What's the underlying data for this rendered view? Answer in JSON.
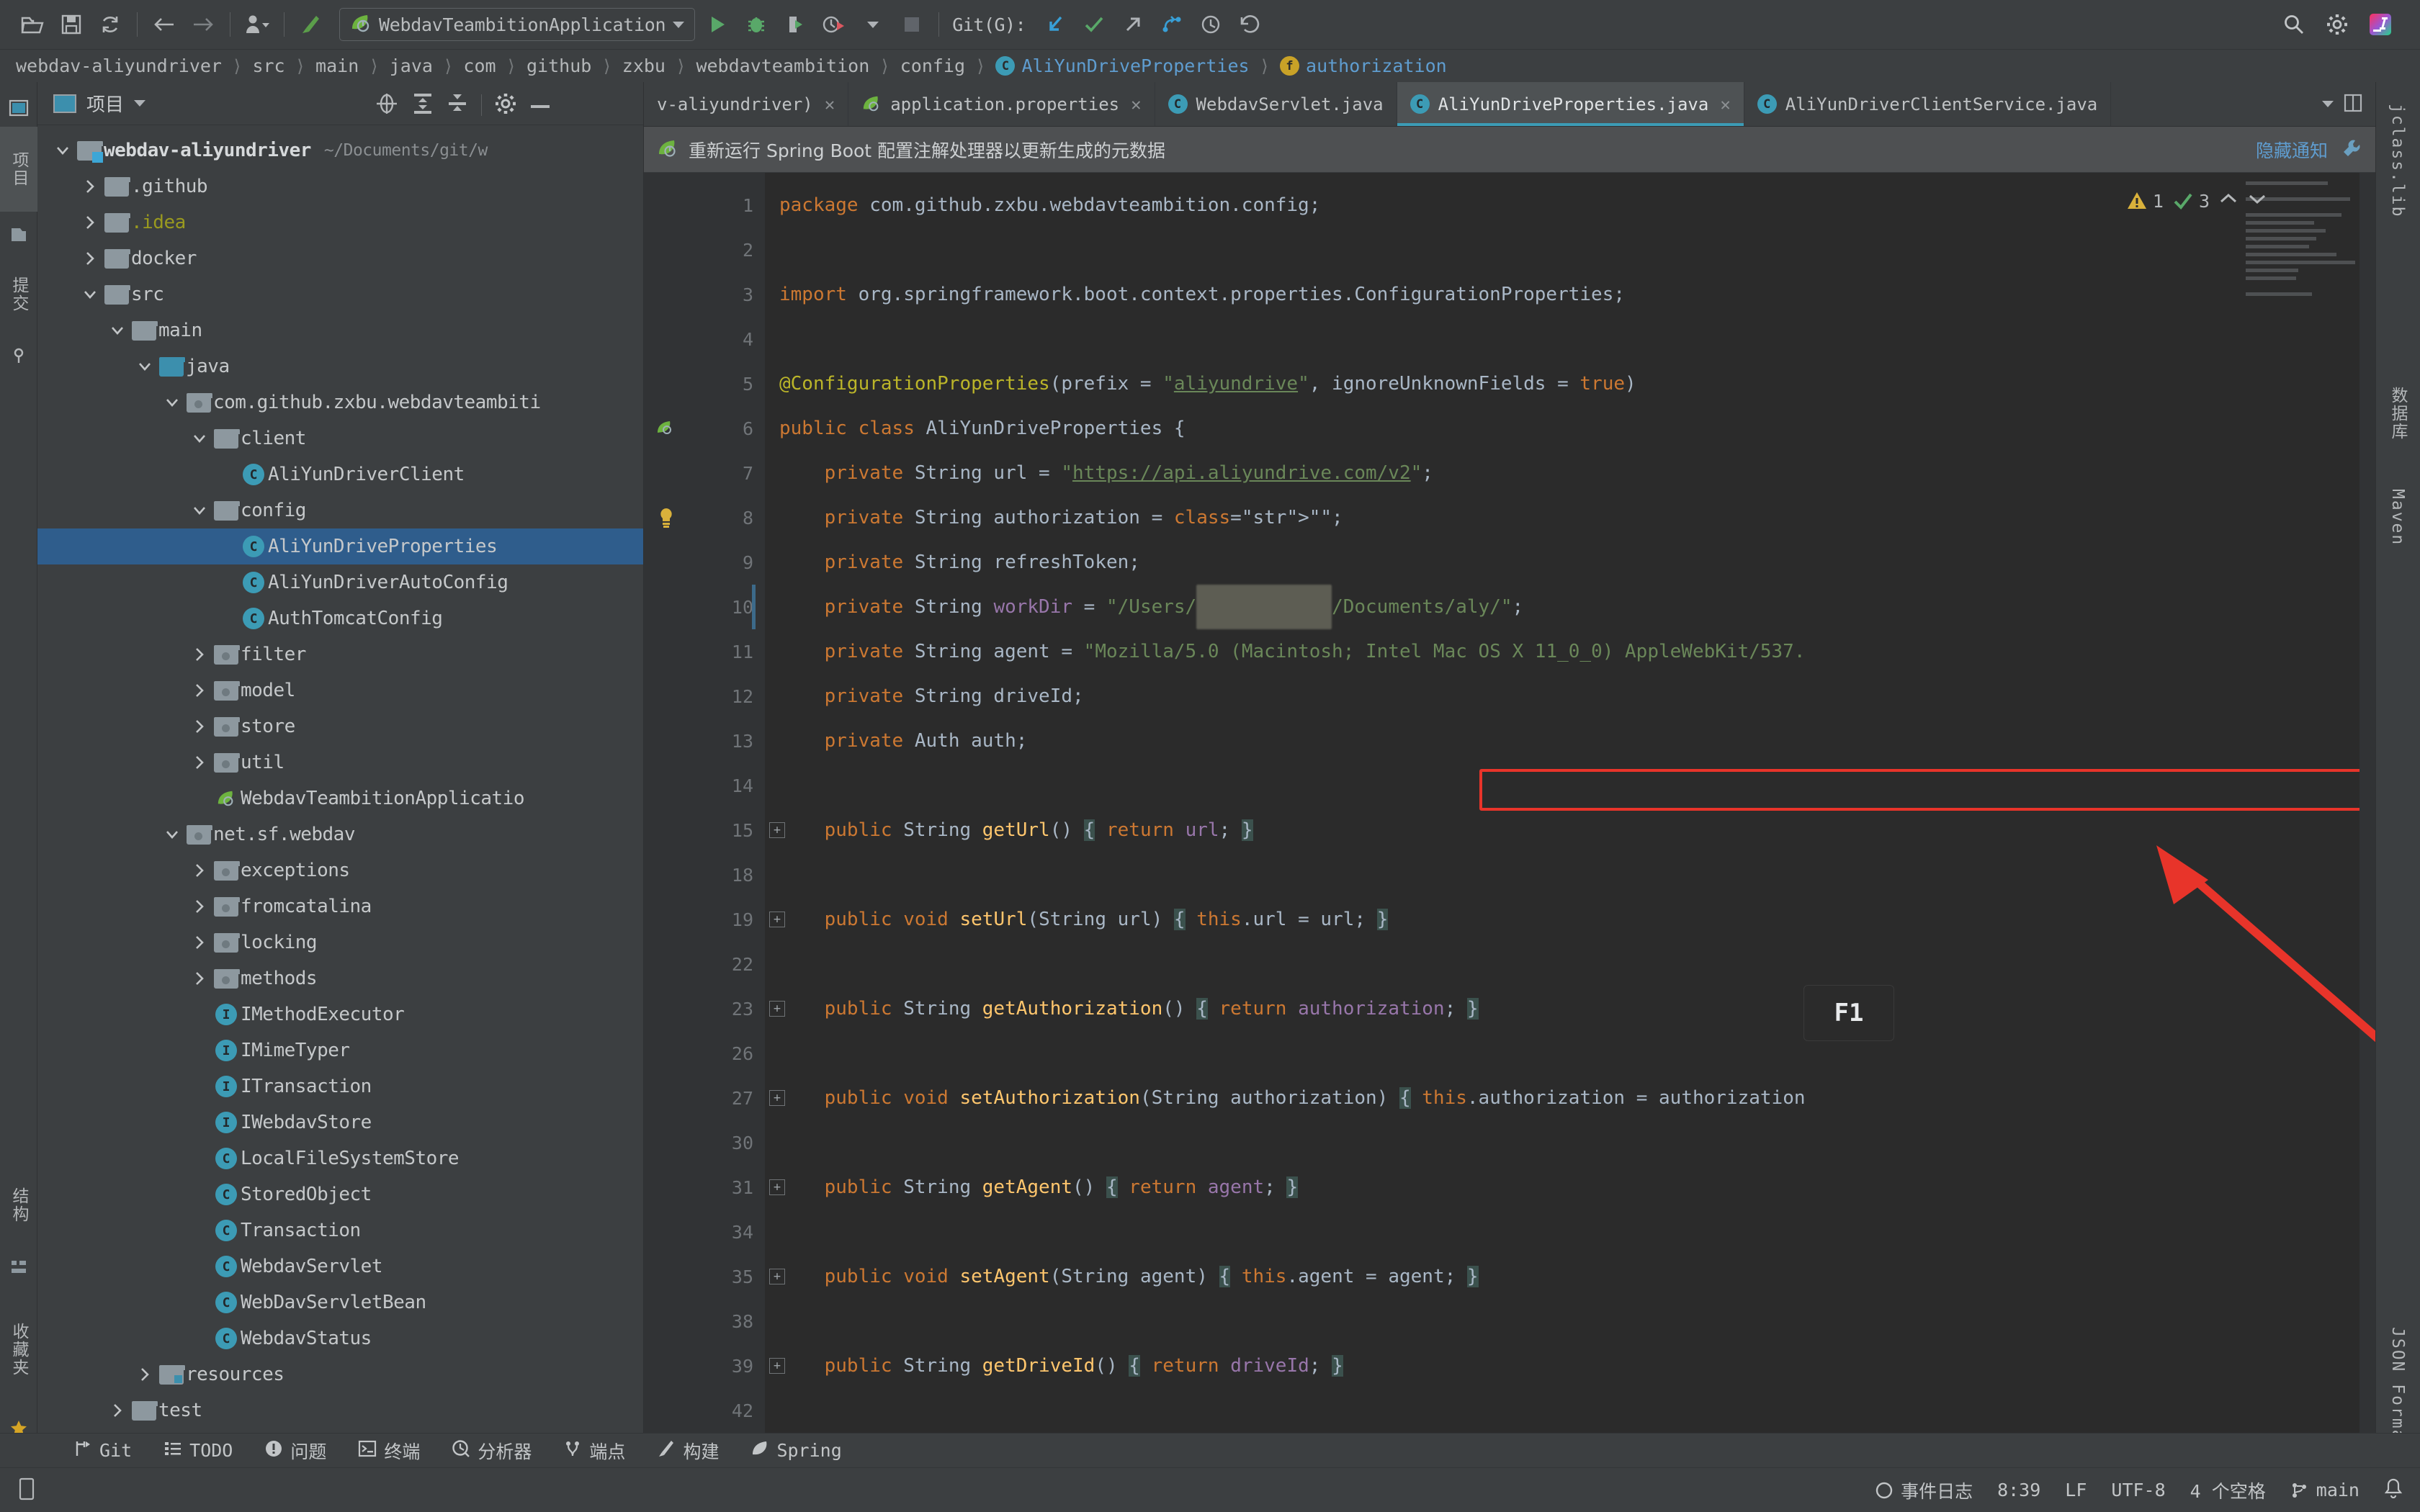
{
  "toolbar": {
    "icons": [
      "open-folder-icon",
      "save-icon",
      "sync-icon",
      "back-arrow-icon",
      "forward-arrow-icon",
      "profiler-icon",
      "build-icon"
    ],
    "run_config": "WebdavTeambitionApplication",
    "git_label": "Git(G):",
    "right_icons": [
      "search-icon",
      "settings-gear-icon",
      "intellij-logo-icon"
    ]
  },
  "breadcrumb": {
    "items": [
      "webdav-aliyundriver",
      "src",
      "main",
      "java",
      "com",
      "github",
      "zxbu",
      "webdavteambition",
      "config"
    ],
    "class_name": "AliYunDriveProperties",
    "field_name": "authorization",
    "class_badge": "C",
    "field_badge": "f"
  },
  "rail_left": {
    "items": [
      "项目",
      "提交",
      "结构",
      "收藏夹"
    ]
  },
  "rail_right": {
    "items": [
      "jclass.lib",
      "数据库",
      "Maven",
      "JSON Formatter"
    ]
  },
  "project_panel": {
    "title": "项目",
    "tree": [
      {
        "label": "webdav-aliyundriver",
        "sub": "~/Documents/git/w",
        "depth": 0,
        "twisty": "down",
        "icon": "module-folder",
        "bold": true
      },
      {
        "label": ".github",
        "depth": 1,
        "twisty": "right",
        "icon": "folder"
      },
      {
        "label": ".idea",
        "depth": 1,
        "twisty": "right",
        "icon": "folder",
        "color": "idea"
      },
      {
        "label": "docker",
        "depth": 1,
        "twisty": "right",
        "icon": "folder"
      },
      {
        "label": "src",
        "depth": 1,
        "twisty": "down",
        "icon": "folder"
      },
      {
        "label": "main",
        "depth": 2,
        "twisty": "down",
        "icon": "folder"
      },
      {
        "label": "java",
        "depth": 3,
        "twisty": "down",
        "icon": "source-folder"
      },
      {
        "label": "com.github.zxbu.webdavteambiti",
        "depth": 4,
        "twisty": "down",
        "icon": "package"
      },
      {
        "label": "client",
        "depth": 5,
        "twisty": "down",
        "icon": "folder"
      },
      {
        "label": "AliYunDriverClient",
        "depth": 6,
        "twisty": "none",
        "icon": "class"
      },
      {
        "label": "config",
        "depth": 5,
        "twisty": "down",
        "icon": "folder"
      },
      {
        "label": "AliYunDriveProperties",
        "depth": 6,
        "twisty": "none",
        "icon": "class",
        "selected": true
      },
      {
        "label": "AliYunDriverAutoConfig",
        "depth": 6,
        "twisty": "none",
        "icon": "class"
      },
      {
        "label": "AuthTomcatConfig",
        "depth": 6,
        "twisty": "none",
        "icon": "class"
      },
      {
        "label": "filter",
        "depth": 5,
        "twisty": "right",
        "icon": "package"
      },
      {
        "label": "model",
        "depth": 5,
        "twisty": "right",
        "icon": "package"
      },
      {
        "label": "store",
        "depth": 5,
        "twisty": "right",
        "icon": "package"
      },
      {
        "label": "util",
        "depth": 5,
        "twisty": "right",
        "icon": "package"
      },
      {
        "label": "WebdavTeambitionApplicatio",
        "depth": 5,
        "twisty": "none",
        "icon": "spring-class"
      },
      {
        "label": "net.sf.webdav",
        "depth": 4,
        "twisty": "down",
        "icon": "package"
      },
      {
        "label": "exceptions",
        "depth": 5,
        "twisty": "right",
        "icon": "package"
      },
      {
        "label": "fromcatalina",
        "depth": 5,
        "twisty": "right",
        "icon": "package"
      },
      {
        "label": "locking",
        "depth": 5,
        "twisty": "right",
        "icon": "package"
      },
      {
        "label": "methods",
        "depth": 5,
        "twisty": "right",
        "icon": "package"
      },
      {
        "label": "IMethodExecutor",
        "depth": 5,
        "twisty": "none",
        "icon": "interface"
      },
      {
        "label": "IMimeTyper",
        "depth": 5,
        "twisty": "none",
        "icon": "interface"
      },
      {
        "label": "ITransaction",
        "depth": 5,
        "twisty": "none",
        "icon": "interface"
      },
      {
        "label": "IWebdavStore",
        "depth": 5,
        "twisty": "none",
        "icon": "interface"
      },
      {
        "label": "LocalFileSystemStore",
        "depth": 5,
        "twisty": "none",
        "icon": "class"
      },
      {
        "label": "StoredObject",
        "depth": 5,
        "twisty": "none",
        "icon": "class"
      },
      {
        "label": "Transaction",
        "depth": 5,
        "twisty": "none",
        "icon": "class"
      },
      {
        "label": "WebdavServlet",
        "depth": 5,
        "twisty": "none",
        "icon": "class"
      },
      {
        "label": "WebDavServletBean",
        "depth": 5,
        "twisty": "none",
        "icon": "class"
      },
      {
        "label": "WebdavStatus",
        "depth": 5,
        "twisty": "none",
        "icon": "class"
      },
      {
        "label": "resources",
        "depth": 3,
        "twisty": "right",
        "icon": "resource-folder"
      },
      {
        "label": "test",
        "depth": 2,
        "twisty": "right",
        "icon": "folder"
      }
    ]
  },
  "editor": {
    "tabs": [
      {
        "label": "v-aliyundriver)",
        "icon": "none",
        "active": false,
        "closable": true
      },
      {
        "label": "application.properties",
        "icon": "spring",
        "active": false,
        "closable": true
      },
      {
        "label": "WebdavServlet.java",
        "icon": "class",
        "active": false,
        "closable": false
      },
      {
        "label": "AliYunDriveProperties.java",
        "icon": "class",
        "active": true,
        "closable": true
      },
      {
        "label": "AliYunDriverClientService.java",
        "icon": "class",
        "active": false,
        "closable": false
      }
    ],
    "notification": "重新运行 Spring Boot 配置注解处理器以更新生成的元数据",
    "notification_hide": "隐藏通知",
    "inspections": {
      "warnings": "1",
      "passed": "3"
    },
    "line_numbers": [
      "1",
      "2",
      "3",
      "4",
      "5",
      "6",
      "7",
      "8",
      "9",
      "10",
      "11",
      "12",
      "13",
      "14",
      "15",
      "18",
      "19",
      "22",
      "23",
      "26",
      "27",
      "30",
      "31",
      "34",
      "35",
      "38",
      "39",
      "42"
    ],
    "code_lines": [
      "package com.github.zxbu.webdavteambition.config;",
      "",
      "import org.springframework.boot.context.properties.ConfigurationProperties;",
      "",
      "@ConfigurationProperties(prefix = \"aliyundrive\", ignoreUnknownFields = true)",
      "public class AliYunDriveProperties {",
      "    private String url = \"https://api.aliyundrive.com/v2\";",
      "    private String authorization = \"\";",
      "    private String refreshToken;",
      "    private String workDir = \"/Users/████████/Documents/aly/\";",
      "    private String agent = \"Mozilla/5.0 (Macintosh; Intel Mac OS X 11_0_0) AppleWebKit/537.\",",
      "    private String driveId;",
      "    private Auth auth;",
      "",
      "    public String getUrl() { return url; }",
      "",
      "    public void setUrl(String url) { this.url = url; }",
      "",
      "    public String getAuthorization() { return authorization; }",
      "",
      "    public void setAuthorization(String authorization) { this.authorization = authorization",
      "",
      "    public String getAgent() { return agent; }",
      "",
      "    public void setAgent(String agent) { this.agent = agent; }",
      "",
      "    public String getDriveId() { return driveId; }",
      ""
    ],
    "overlay_key": "F1"
  },
  "bottom_bar": {
    "items": [
      {
        "label": "Git",
        "icon": "git-branch-icon"
      },
      {
        "label": "TODO",
        "icon": "todo-list-icon"
      },
      {
        "label": "问题",
        "icon": "problems-icon"
      },
      {
        "label": "终端",
        "icon": "terminal-icon"
      },
      {
        "label": "分析器",
        "icon": "profiler-icon"
      },
      {
        "label": "端点",
        "icon": "endpoints-icon"
      },
      {
        "label": "构建",
        "icon": "build-icon"
      },
      {
        "label": "Spring",
        "icon": "spring-leaf-icon"
      }
    ]
  },
  "status_bar": {
    "event_log": "事件日志",
    "position": "8:39",
    "line_sep": "LF",
    "encoding": "UTF-8",
    "indent": "4 个空格",
    "branch": "main"
  },
  "colors": {
    "accent": "#3c9bb5",
    "selection": "#2f5d8c",
    "highlight_red": "#e8342a",
    "spring_green": "#6db33f",
    "editor_bg": "#2b2b2b",
    "panel_bg": "#3c3f41"
  }
}
